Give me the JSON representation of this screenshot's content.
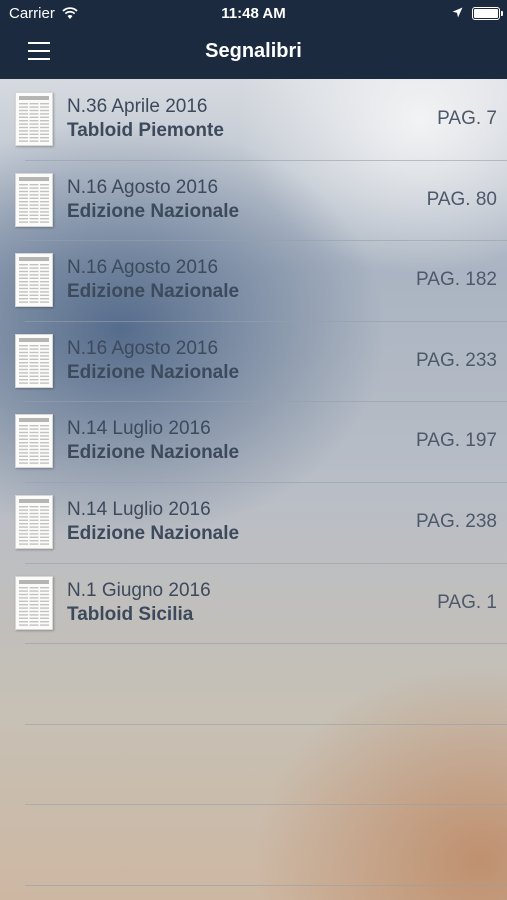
{
  "status_bar": {
    "carrier": "Carrier",
    "time": "11:48 AM",
    "icons": [
      "wifi-icon",
      "location-arrow-icon",
      "battery-icon"
    ]
  },
  "nav": {
    "title": "Segnalibri",
    "menu_icon": "hamburger-menu-icon"
  },
  "colors": {
    "nav_bar": "#1b2a3f",
    "text": "#3c4a5c"
  },
  "bookmarks": [
    {
      "issue": "N.36 Aprile 2016",
      "edition": "Tabloid Piemonte",
      "page": "PAG. 7"
    },
    {
      "issue": "N.16 Agosto 2016",
      "edition": "Edizione Nazionale",
      "page": "PAG. 80"
    },
    {
      "issue": "N.16 Agosto 2016",
      "edition": "Edizione Nazionale",
      "page": "PAG. 182"
    },
    {
      "issue": "N.16 Agosto 2016",
      "edition": "Edizione Nazionale",
      "page": "PAG. 233"
    },
    {
      "issue": "N.14 Luglio 2016",
      "edition": "Edizione Nazionale",
      "page": "PAG. 197"
    },
    {
      "issue": "N.14 Luglio 2016",
      "edition": "Edizione Nazionale",
      "page": "PAG. 238"
    },
    {
      "issue": "N.1 Giugno 2016",
      "edition": "Tabloid Sicilia",
      "page": "PAG. 1"
    }
  ]
}
